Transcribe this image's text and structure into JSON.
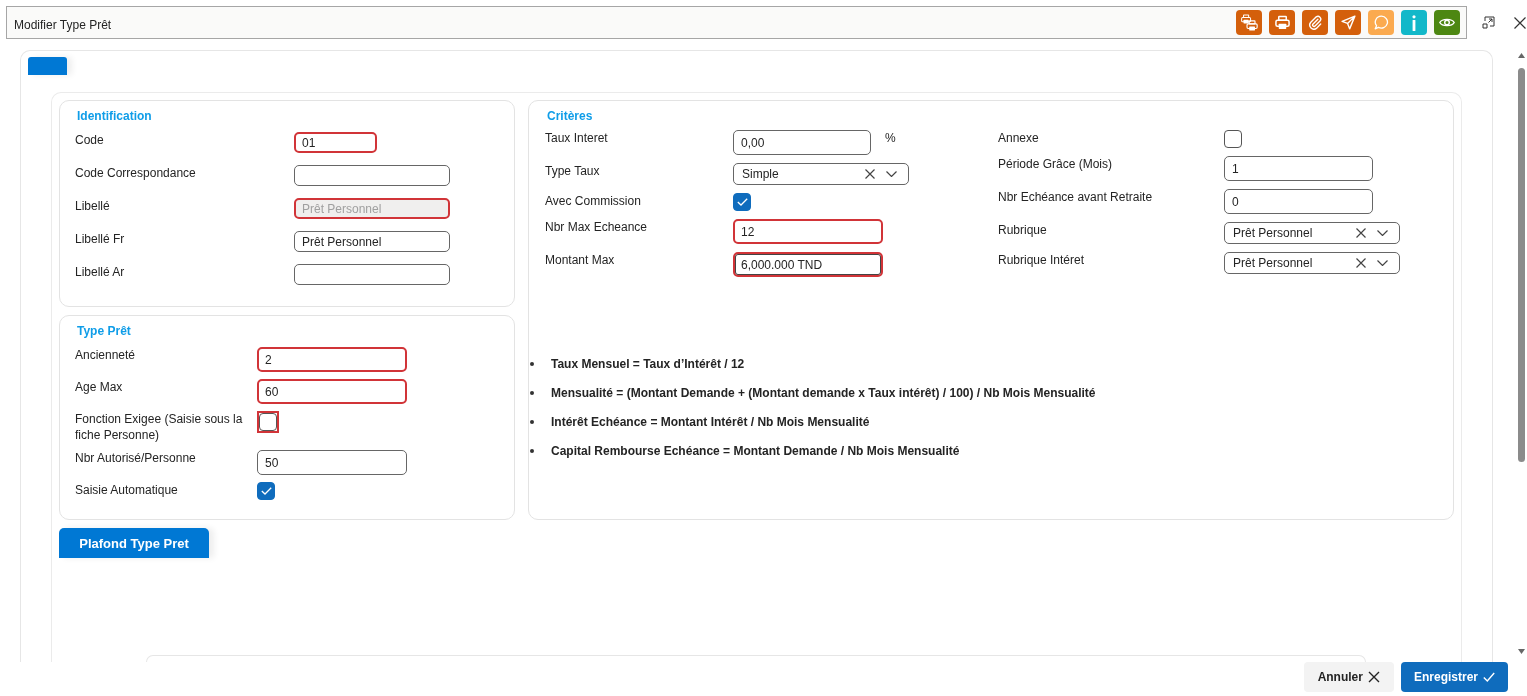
{
  "window": {
    "title": "Modifier Type Prêt"
  },
  "toolbar": [
    {
      "color": "#d45f0b"
    },
    {
      "color": "#d45f0b"
    },
    {
      "color": "#d45f0b"
    },
    {
      "color": "#d45f0b"
    },
    {
      "color": "#fbaa4f"
    },
    {
      "color": "#12b8c9"
    },
    {
      "color": "#4d8712"
    }
  ],
  "sections": [
    {
      "title": "Identification",
      "fields": [
        {
          "label": "Code",
          "kind": "short_text",
          "value": "01",
          "error": true,
          "disabled": false,
          "focused": false
        },
        {
          "label": "Code Correspondance",
          "kind": "text",
          "error": false,
          "disabled": false,
          "focused": false
        },
        {
          "label": "Libellé",
          "kind": "text",
          "value": "Prêt Personnel",
          "error": true,
          "disabled": true,
          "focused": false
        },
        {
          "label": "Libellé Fr",
          "kind": "text",
          "value": "Prêt Personnel",
          "error": false,
          "disabled": false,
          "focused": false
        },
        {
          "label": "Libellé Ar",
          "kind": "text",
          "error": false,
          "disabled": false,
          "focused": false
        }
      ]
    },
    {
      "title": "Type Prêt",
      "fields": [
        {
          "label": "Ancienneté",
          "kind": "text",
          "value": "2",
          "error": true,
          "disabled": false,
          "focused": false
        },
        {
          "label": "Age Max",
          "kind": "text",
          "value": "60",
          "error": true,
          "disabled": false,
          "focused": false
        },
        {
          "label": "Fonction Exigee (Saisie sous la fiche Personne)",
          "kind": "checkbox",
          "checked": false,
          "error": true,
          "disabled": false,
          "focused": false
        },
        {
          "label": "Nbr Autorisé/Personne",
          "kind": "text",
          "value": "50",
          "error": false,
          "disabled": false,
          "focused": false
        },
        {
          "label": "Saisie Automatique",
          "kind": "checkbox",
          "checked": true,
          "error": false,
          "disabled": false,
          "focused": false
        }
      ]
    }
  ],
  "criteres": {
    "title": "Critères",
    "columns": [
      [
        {
          "label": "Taux Interet",
          "kind": "text",
          "value": "0,00",
          "suffix": "%",
          "error": false,
          "disabled": false,
          "focused": false
        },
        {
          "label": "Type Taux",
          "kind": "select",
          "value": "Simple",
          "error": false,
          "disabled": false,
          "focused": false
        },
        {
          "label": "Avec Commission",
          "kind": "checkbox",
          "checked": true,
          "error": false,
          "disabled": false,
          "focused": false
        },
        {
          "label": "Nbr Max Echeance",
          "kind": "text",
          "value": "12",
          "error": true,
          "disabled": false,
          "focused": false
        },
        {
          "label": "Montant Max",
          "kind": "text",
          "value": "6,000.000 TND",
          "error": true,
          "disabled": false,
          "focused": true
        }
      ],
      [
        {
          "label": "Annexe",
          "kind": "checkbox",
          "checked": false,
          "error": false,
          "disabled": false,
          "focused": false
        },
        {
          "label": "Période Grâce (Mois)",
          "kind": "text",
          "value": "1",
          "error": false,
          "disabled": false,
          "focused": false
        },
        {
          "label": "Nbr Echéance avant Retraite",
          "kind": "text",
          "value": "0",
          "error": false,
          "disabled": false,
          "focused": false
        },
        {
          "label": "Rubrique",
          "kind": "select",
          "value": "Prêt Personnel",
          "error": false,
          "disabled": false,
          "focused": false
        },
        {
          "label": "Rubrique Intéret",
          "kind": "select",
          "value": "Prêt Personnel",
          "error": false,
          "disabled": false,
          "focused": false
        }
      ]
    ],
    "formulas": [
      "Taux Mensuel = Taux d’Intérêt / 12",
      "Mensualité = (Montant Demande + (Montant demande x Taux intérêt) / 100) / Nb Mois Mensualité",
      "Intérêt Echéance = Montant Intérêt / Nb Mois Mensualité",
      "Capital Rembourse Echéance = Montant Demande / Nb Mois Mensualité"
    ]
  },
  "tabs": [
    {
      "label": "Plafond Type Pret",
      "selected": true
    }
  ],
  "footer": {
    "buttons": [
      {
        "label": "Annuler",
        "kind": "cancel"
      },
      {
        "label": "Enregistrer",
        "kind": "submit"
      }
    ]
  }
}
